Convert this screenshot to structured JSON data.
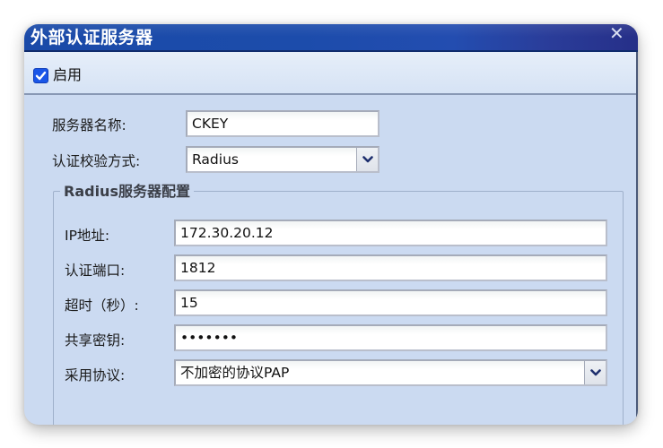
{
  "window": {
    "title": "外部认证服务器",
    "close_icon": "close-icon"
  },
  "enable": {
    "label": "启用",
    "checked": true
  },
  "form": {
    "server_name": {
      "label": "服务器名称:",
      "value": "CKEY"
    },
    "auth_method": {
      "label": "认证校验方式:",
      "value": "Radius"
    }
  },
  "radius": {
    "legend": "Radius服务器配置",
    "ip": {
      "label": "IP地址:",
      "value": "172.30.20.12"
    },
    "port": {
      "label": "认证端口:",
      "value": "1812"
    },
    "timeout": {
      "label": "超时（秒）:",
      "value": "15"
    },
    "secret": {
      "label": "共享密钥:",
      "value": "•••••••"
    },
    "protocol": {
      "label": "采用协议:",
      "value": "不加密的协议PAP"
    }
  },
  "colors": {
    "titlebar": "#1a4aa8",
    "body": "#cbdaf1",
    "checkbox": "#1a56e8",
    "arrow": "#1e2f6e"
  }
}
